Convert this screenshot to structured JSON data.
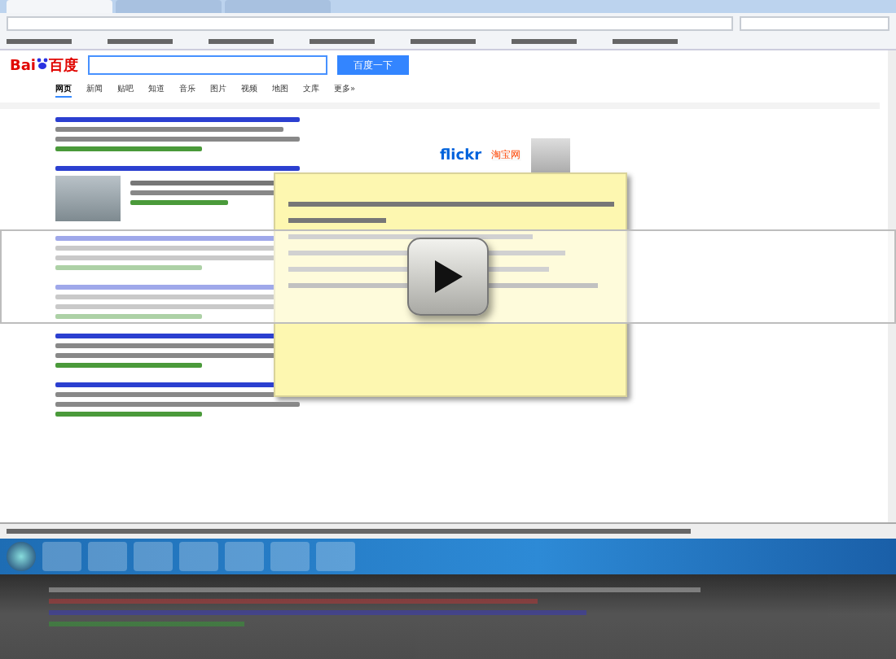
{
  "browser": {
    "tabs": [
      {
        "selected": true
      },
      {
        "selected": false
      },
      {
        "selected": false
      }
    ]
  },
  "search": {
    "logo_left": "Bai",
    "logo_right": "百度",
    "button": "百度一下"
  },
  "nav_tabs": [
    {
      "label": "网页",
      "selected": true
    },
    {
      "label": "新闻",
      "selected": false
    },
    {
      "label": "贴吧",
      "selected": false
    },
    {
      "label": "知道",
      "selected": false
    },
    {
      "label": "音乐",
      "selected": false
    },
    {
      "label": "图片",
      "selected": false
    },
    {
      "label": "视频",
      "selected": false
    },
    {
      "label": "地图",
      "selected": false
    },
    {
      "label": "文库",
      "selected": false
    },
    {
      "label": "更多»",
      "selected": false
    }
  ],
  "results": [
    {
      "kind": "plain"
    },
    {
      "kind": "thumbnail"
    },
    {
      "kind": "plain"
    },
    {
      "kind": "plain"
    },
    {
      "kind": "plain"
    },
    {
      "kind": "plain"
    }
  ],
  "sidebar": {
    "logos": [
      "flickr",
      "淘宝网"
    ]
  },
  "video": {
    "playing": false
  }
}
